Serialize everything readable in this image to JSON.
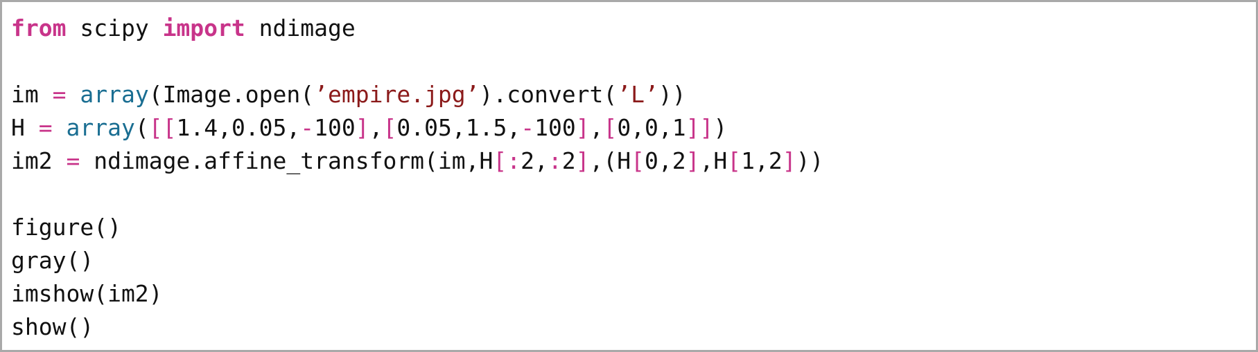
{
  "code_lines": [
    [
      {
        "text": "from",
        "type": "kw"
      },
      {
        "text": " scipy ",
        "type": "plain"
      },
      {
        "text": "import",
        "type": "kw"
      },
      {
        "text": " ndimage",
        "type": "plain"
      }
    ],
    [],
    [
      {
        "text": "im ",
        "type": "plain"
      },
      {
        "text": "=",
        "type": "op"
      },
      {
        "text": " ",
        "type": "plain"
      },
      {
        "text": "array",
        "type": "fn"
      },
      {
        "text": "(Image.open(",
        "type": "plain"
      },
      {
        "text": "’empire.jpg’",
        "type": "str"
      },
      {
        "text": ").convert(",
        "type": "plain"
      },
      {
        "text": "’L’",
        "type": "str"
      },
      {
        "text": "))",
        "type": "plain"
      }
    ],
    [
      {
        "text": "H ",
        "type": "plain"
      },
      {
        "text": "=",
        "type": "op"
      },
      {
        "text": " ",
        "type": "plain"
      },
      {
        "text": "array",
        "type": "fn"
      },
      {
        "text": "(",
        "type": "plain"
      },
      {
        "text": "[[",
        "type": "op"
      },
      {
        "text": "1.4,0.05,",
        "type": "plain"
      },
      {
        "text": "-",
        "type": "op"
      },
      {
        "text": "100",
        "type": "plain"
      },
      {
        "text": "]",
        "type": "op"
      },
      {
        "text": ",",
        "type": "plain"
      },
      {
        "text": "[",
        "type": "op"
      },
      {
        "text": "0.05,1.5,",
        "type": "plain"
      },
      {
        "text": "-",
        "type": "op"
      },
      {
        "text": "100",
        "type": "plain"
      },
      {
        "text": "]",
        "type": "op"
      },
      {
        "text": ",",
        "type": "plain"
      },
      {
        "text": "[",
        "type": "op"
      },
      {
        "text": "0,0,1",
        "type": "plain"
      },
      {
        "text": "]]",
        "type": "op"
      },
      {
        "text": ")",
        "type": "plain"
      }
    ],
    [
      {
        "text": "im2 ",
        "type": "plain"
      },
      {
        "text": "=",
        "type": "op"
      },
      {
        "text": " ndimage.affine_transform(im,H",
        "type": "plain"
      },
      {
        "text": "[:",
        "type": "op"
      },
      {
        "text": "2,",
        "type": "plain"
      },
      {
        "text": ":",
        "type": "op"
      },
      {
        "text": "2",
        "type": "plain"
      },
      {
        "text": "]",
        "type": "op"
      },
      {
        "text": ",(H",
        "type": "plain"
      },
      {
        "text": "[",
        "type": "op"
      },
      {
        "text": "0,2",
        "type": "plain"
      },
      {
        "text": "]",
        "type": "op"
      },
      {
        "text": ",H",
        "type": "plain"
      },
      {
        "text": "[",
        "type": "op"
      },
      {
        "text": "1,2",
        "type": "plain"
      },
      {
        "text": "]",
        "type": "op"
      },
      {
        "text": "))",
        "type": "plain"
      }
    ],
    [],
    [
      {
        "text": "figure()",
        "type": "plain"
      }
    ],
    [
      {
        "text": "gray()",
        "type": "plain"
      }
    ],
    [
      {
        "text": "imshow(im2)",
        "type": "plain"
      }
    ],
    [
      {
        "text": "show()",
        "type": "plain"
      }
    ]
  ]
}
